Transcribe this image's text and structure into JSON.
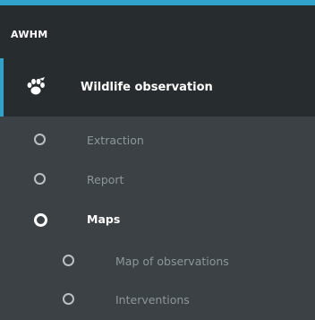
{
  "app": {
    "title": "AWHM"
  },
  "section": {
    "label": "Wildlife observation",
    "icon": "paw-icon"
  },
  "menu": {
    "items": [
      {
        "label": "Extraction",
        "state": "default"
      },
      {
        "label": "Report",
        "state": "default"
      },
      {
        "label": "Maps",
        "state": "active"
      }
    ],
    "subitems": [
      {
        "label": "Map of observations",
        "state": "default"
      },
      {
        "label": "Interventions",
        "state": "default"
      }
    ]
  },
  "colors": {
    "accent": "#2fa3c9",
    "header_bg": "#272c2e",
    "menu_bg": "#3b4144",
    "text_muted": "#8d969a",
    "text_active": "#ffffff"
  }
}
